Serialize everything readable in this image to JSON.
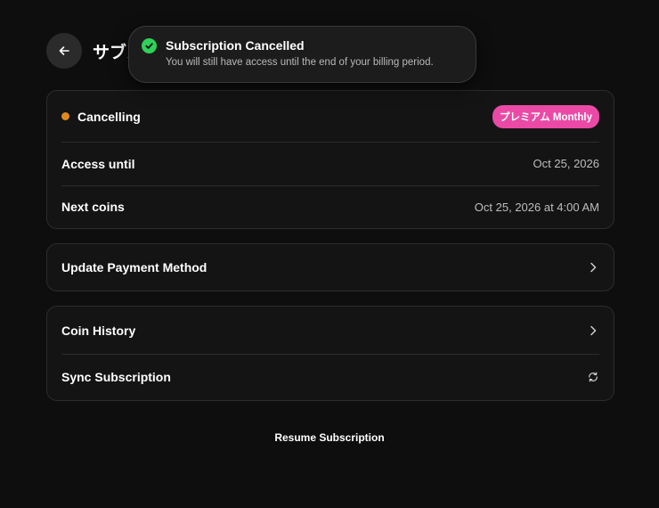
{
  "header": {
    "title": "サブスクリプション"
  },
  "status_card": {
    "status_label": "Cancelling",
    "status_color": "#e08a1e",
    "plan_badge": "プレミアム Monthly",
    "badge_color": "#ea4aa6",
    "rows": [
      {
        "label": "Access until",
        "value": "Oct 25, 2026"
      },
      {
        "label": "Next coins",
        "value": "Oct 25, 2026 at 4:00 AM"
      }
    ]
  },
  "payment_card": {
    "label": "Update Payment Method",
    "icon": "chevron-right-icon"
  },
  "actions_card": {
    "coin_history_label": "Coin History",
    "sync_label": "Sync Subscription",
    "sync_icon": "refresh-icon"
  },
  "footer": {
    "resume_label": "Resume Subscription"
  },
  "toast": {
    "title": "Subscription Cancelled",
    "message": "You will still have access until the end of your billing period.",
    "icon": "check-circle-icon",
    "icon_color": "#2fd15a"
  }
}
